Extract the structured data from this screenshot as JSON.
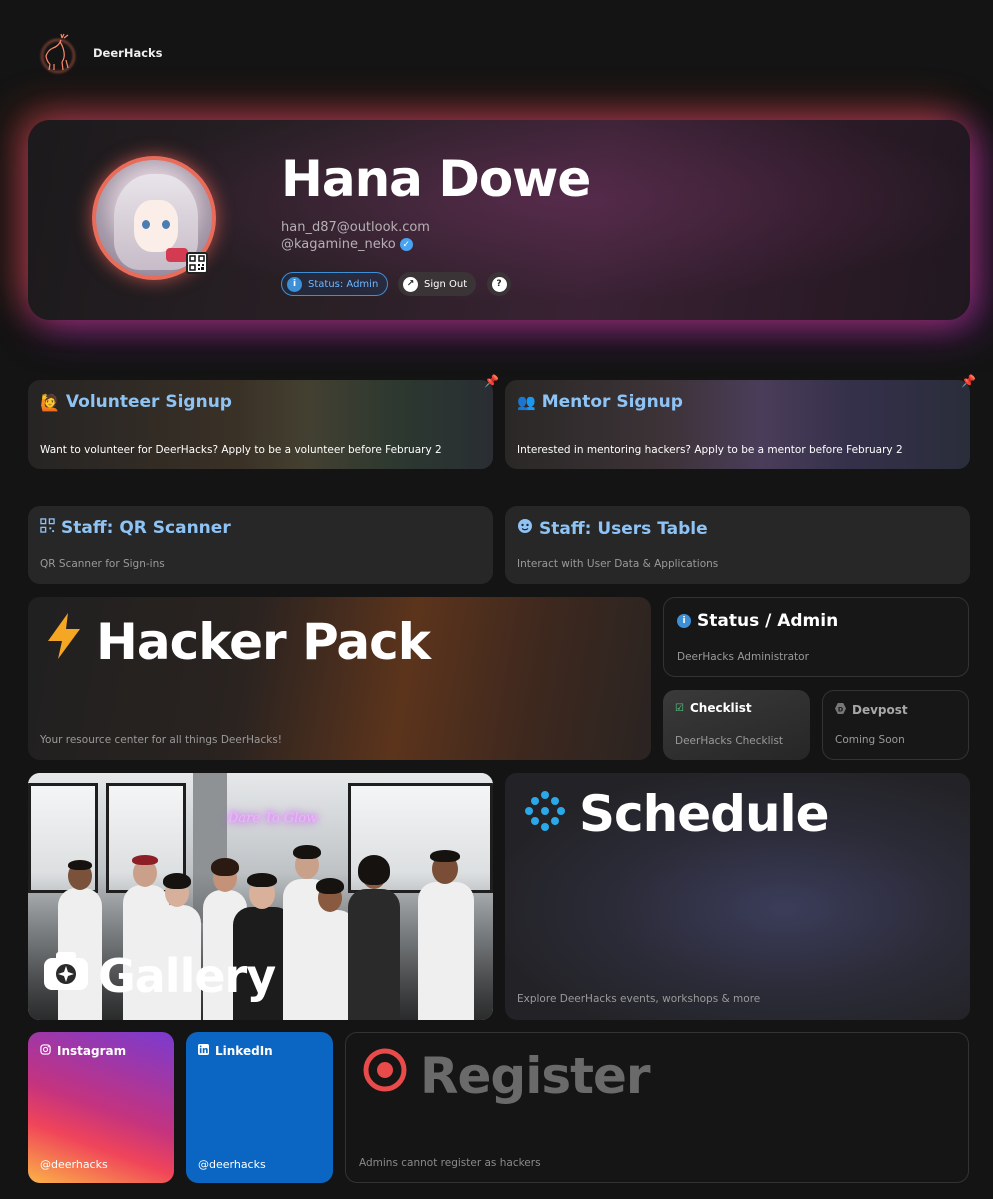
{
  "header": {
    "brand": "DeerHacks"
  },
  "profile": {
    "name": "Hana Dowe",
    "email": "han_d87@outlook.com",
    "handle": "@kagamine_neko",
    "status_pill": "Status: Admin",
    "signout_label": "Sign Out",
    "help_label": "?"
  },
  "cards": {
    "volunteer": {
      "title": "Volunteer Signup",
      "desc": "Want to volunteer for DeerHacks? Apply to be a volunteer before February 2"
    },
    "mentor": {
      "title": "Mentor Signup",
      "desc": "Interested in mentoring hackers? Apply to be a mentor before February 2"
    },
    "qr": {
      "title": "Staff: QR Scanner",
      "desc": "QR Scanner for Sign-ins"
    },
    "users": {
      "title": "Staff: Users Table",
      "desc": "Interact with User Data & Applications"
    },
    "hacker": {
      "title": "Hacker Pack",
      "desc": "Your resource center for all things DeerHacks!"
    },
    "status": {
      "title": "Status / Admin",
      "desc": "DeerHacks Administrator"
    },
    "checklist": {
      "title": "Checklist",
      "desc": "DeerHacks Checklist"
    },
    "devpost": {
      "title": "Devpost",
      "desc": "Coming Soon"
    },
    "gallery": {
      "title": "Gallery",
      "neon": "Dare To Glow"
    },
    "schedule": {
      "title": "Schedule",
      "desc": "Explore DeerHacks events, workshops & more"
    },
    "instagram": {
      "title": "Instagram",
      "handle": "@deerhacks"
    },
    "linkedin": {
      "title": "LinkedIn",
      "handle": "@deerhacks"
    },
    "register": {
      "title": "Register",
      "desc": "Admins cannot register as hackers"
    }
  },
  "colors": {
    "accent_blue": "#6fb6ff",
    "card_title_blue": "#8ec3f5",
    "hacker_orange": "#f5a623",
    "schedule_blue": "#2aa8e8",
    "register_red": "#e94a4a",
    "profile_glow_orange": "#e96c5a",
    "profile_glow_purple": "#a43cd0"
  },
  "icons": {
    "logo": "deer-logo-icon",
    "volunteer": "person-raising-hand-icon",
    "mentor": "mentor-icon",
    "qr": "qr-code-icon",
    "users": "user-face-icon",
    "hacker": "lightning-bolt-icon",
    "status": "info-icon",
    "checklist": "checklist-icon",
    "devpost": "devpost-icon",
    "gallery": "camera-icon",
    "schedule": "dots-cluster-icon",
    "instagram": "instagram-icon",
    "linkedin": "linkedin-icon",
    "register": "record-circle-icon",
    "pin": "pin-icon"
  }
}
